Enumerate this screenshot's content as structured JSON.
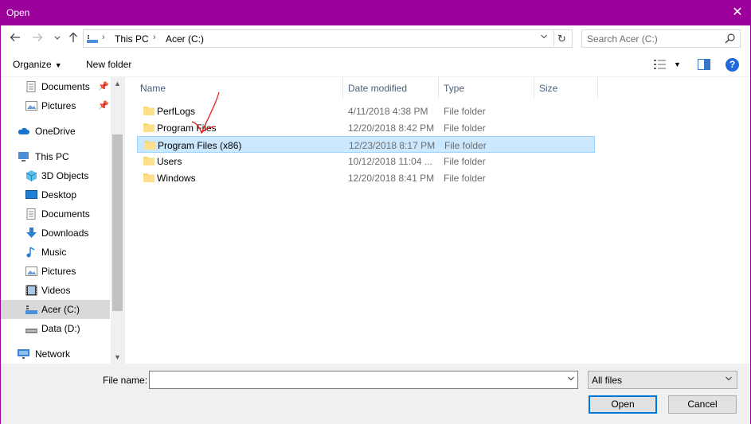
{
  "window": {
    "title": "Open",
    "accent_color": "#9b009b",
    "close_icon": "close-icon"
  },
  "address": {
    "back_icon": "arrow-left-icon",
    "forward_icon": "arrow-right-icon",
    "recent_icon": "chevron-down-icon",
    "up_icon": "arrow-up-icon",
    "crumbs": [
      "This PC",
      "Acer (C:)"
    ],
    "refresh_icon": "refresh-icon"
  },
  "search": {
    "placeholder": "Search Acer (C:)"
  },
  "toolbar": {
    "organize_label": "Organize",
    "new_folder_label": "New folder",
    "help_label": "?"
  },
  "nav": {
    "items": [
      {
        "label": "Documents",
        "icon": "documents-icon",
        "pinned": true
      },
      {
        "label": "Pictures",
        "icon": "pictures-icon",
        "pinned": true
      },
      {
        "label": "OneDrive",
        "icon": "cloud-icon"
      },
      {
        "label": "This PC",
        "icon": "computer-icon"
      },
      {
        "label": "3D Objects",
        "icon": "cube-icon"
      },
      {
        "label": "Desktop",
        "icon": "desktop-icon"
      },
      {
        "label": "Documents",
        "icon": "documents-icon"
      },
      {
        "label": "Downloads",
        "icon": "download-icon"
      },
      {
        "label": "Music",
        "icon": "music-icon"
      },
      {
        "label": "Pictures",
        "icon": "pictures-icon"
      },
      {
        "label": "Videos",
        "icon": "video-icon"
      },
      {
        "label": "Acer (C:)",
        "icon": "drive-icon",
        "selected": true
      },
      {
        "label": "Data (D:)",
        "icon": "drive-icon"
      },
      {
        "label": "Network",
        "icon": "network-icon"
      }
    ]
  },
  "files": {
    "columns": [
      "Name",
      "Date modified",
      "Type",
      "Size"
    ],
    "rows": [
      {
        "name": "PerfLogs",
        "date": "4/11/2018 4:38 PM",
        "type": "File folder"
      },
      {
        "name": "Program Files",
        "date": "12/20/2018 8:42 PM",
        "type": "File folder"
      },
      {
        "name": "Program Files (x86)",
        "date": "12/23/2018 8:17 PM",
        "type": "File folder",
        "selected": true
      },
      {
        "name": "Users",
        "date": "10/12/2018 11:04 ...",
        "type": "File folder"
      },
      {
        "name": "Windows",
        "date": "12/20/2018 8:41 PM",
        "type": "File folder"
      }
    ]
  },
  "bottom": {
    "file_name_label": "File name:",
    "file_name_value": "",
    "file_type": "All files",
    "open_label": "Open",
    "cancel_label": "Cancel"
  }
}
